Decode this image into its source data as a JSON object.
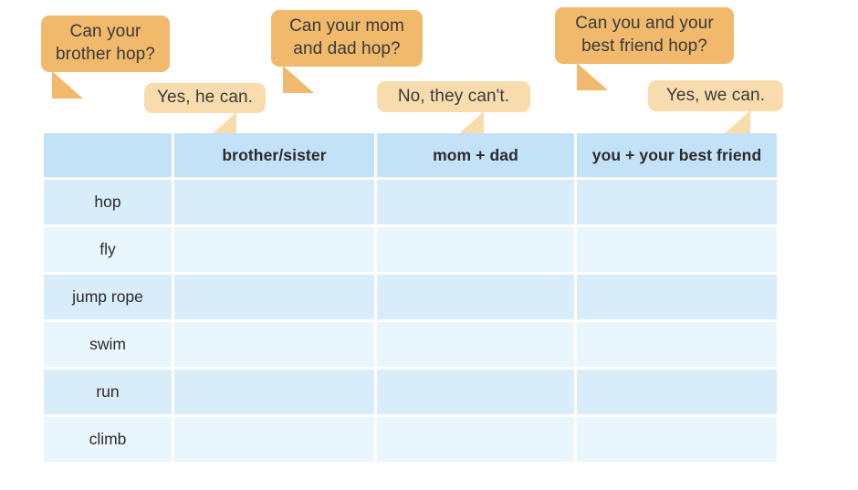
{
  "page": {
    "background_color": "#ffffff",
    "type": "worksheet-activity-table"
  },
  "palette": {
    "question_bubble": "#f0b96c",
    "answer_bubble": "#f9dcae",
    "table_header": "#c3e2f7",
    "row_shade": "#d8ecf9",
    "row_light": "#eaf6fd",
    "text": "#2b2b2b"
  },
  "dialogues": [
    {
      "question": "Can your\nbrother hop?",
      "answer": "Yes, he can."
    },
    {
      "question": "Can your mom\nand dad hop?",
      "answer": "No, they can't."
    },
    {
      "question": "Can you and your\nbest friend hop?",
      "answer": "Yes, we can."
    }
  ],
  "table": {
    "corner_label": "",
    "columns": [
      "brother/sister",
      "mom + dad",
      "you + your best friend"
    ],
    "rows": [
      {
        "label": "hop",
        "cells": [
          "",
          "",
          ""
        ]
      },
      {
        "label": "fly",
        "cells": [
          "",
          "",
          ""
        ]
      },
      {
        "label": "jump rope",
        "cells": [
          "",
          "",
          ""
        ]
      },
      {
        "label": "swim",
        "cells": [
          "",
          "",
          ""
        ]
      },
      {
        "label": "run",
        "cells": [
          "",
          "",
          ""
        ]
      },
      {
        "label": "climb",
        "cells": [
          "",
          "",
          ""
        ]
      }
    ]
  }
}
